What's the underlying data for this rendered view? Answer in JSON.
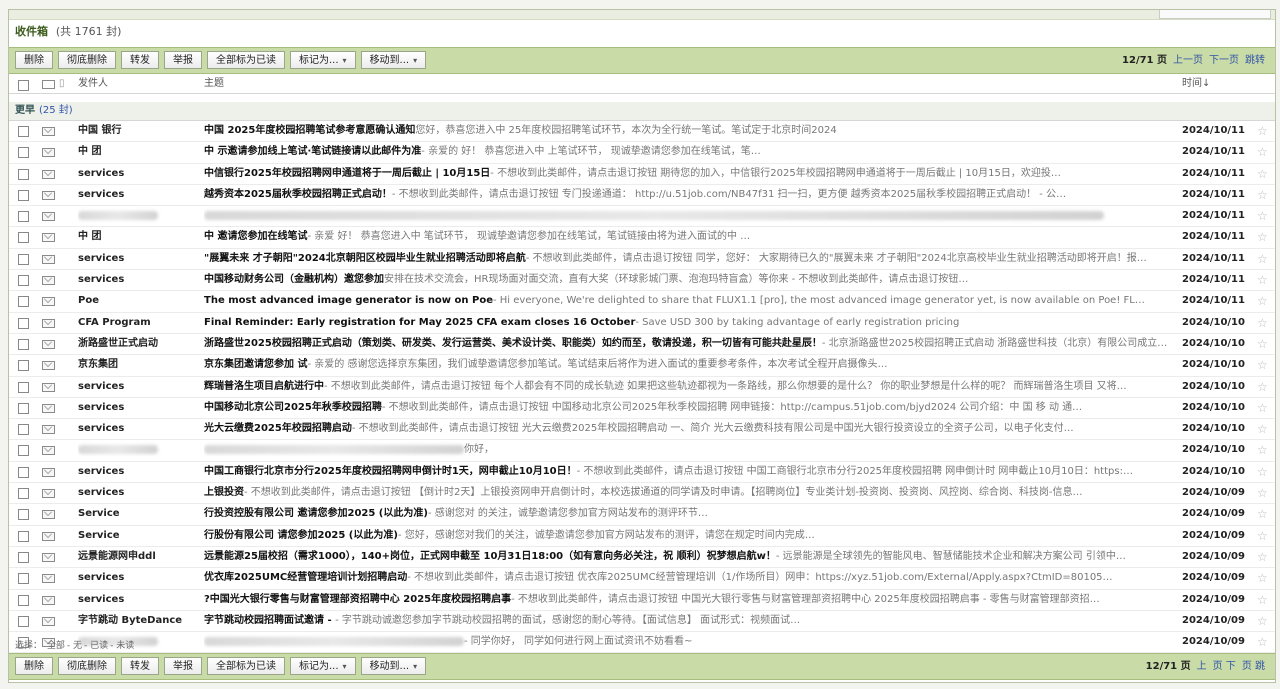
{
  "folder": {
    "title": "收件箱",
    "count": "(共 1761 封)"
  },
  "toolbar": {
    "buttons": [
      "删除",
      "彻底删除",
      "转发",
      "举报",
      "全部标为已读",
      "标记为...",
      "移动到..."
    ],
    "dropdown_caret": "▾",
    "page_top": "12/71 页",
    "prev": "上一页",
    "next": "下一页",
    "jump": "跳转",
    "page_bottom": "12/71 页",
    "bottom_up": "上",
    "bottom_down": "页 下",
    "bottom_jump": "页 跳"
  },
  "columns": {
    "sender": "发件人",
    "subject": "主题",
    "time": "时间↓"
  },
  "group": {
    "label": "更早",
    "count": "(25 封)"
  },
  "emails": [
    {
      "sender": "中国 银行",
      "subject": "中国 2025年度校园招聘笔试参考意愿确认通知",
      "preview": "您好，恭喜您进入中 25年度校园招聘笔试环节，本次为全行统一笔试。笔试定于北京时间2024",
      "date": "2024/10/11"
    },
    {
      "sender": "中  团",
      "subject": "中 示邀请参加线上笔试·笔试链接请以此邮件为准",
      "preview": "- 亲爱的 好！ 恭喜您进入中 上笔试环节， 现诚挚邀请您参加在线笔试，笔…",
      "date": "2024/10/11"
    },
    {
      "sender": "services",
      "subject": "中信银行2025年校园招聘网申通道将于一周后截止 | 10月15日",
      "preview": "- 不想收到此类邮件，请点击退订按钮 期待您的加入，中信银行2025年校园招聘网申通道将于一周后截止 | 10月15日，欢迎投…",
      "date": "2024/10/11"
    },
    {
      "sender": "services",
      "subject": "越秀资本2025届秋季校园招聘正式启动！",
      "preview": "- 不想收到此类邮件，请点击退订按钮 专门投递通道： http://u.51job.com/NB47f31 扫一扫，更方便 越秀资本2025届秋季校园招聘正式启动！ - 公…",
      "date": "2024/10/11"
    },
    {
      "sender": "",
      "subject": "",
      "preview": "",
      "date": "2024/10/11"
    },
    {
      "sender": "中  团",
      "subject": "中 邀请您参加在线笔试",
      "preview": "- 亲爱 好！ 恭喜您进入中 笔试环节， 现诚挚邀请您参加在线笔试，笔试链接由将为进入面试的中 …",
      "date": "2024/10/11"
    },
    {
      "sender": "services",
      "subject": "\"展翼未来 才子朝阳\"2024北京朝阳区校园毕业生就业招聘活动即将启航",
      "preview": "- 不想收到此类邮件，请点击退订按钮 同学，您好： 大家期待已久的\"展翼未来 才子朝阳\"2024北京高校毕业生就业招聘活动即将开启！报…",
      "date": "2024/10/11"
    },
    {
      "sender": "services",
      "subject": "中国移动财务公司（金融机构）邀您参加",
      "preview": "安排在技术交流会，HR现场面对面交流，直有大奖（环球影城门票、泡泡玛特盲盒）等你来 - 不想收到此类邮件，请点击退订按钮…",
      "date": "2024/10/11"
    },
    {
      "sender": "Poe",
      "subject": "The most advanced image generator is now on Poe",
      "preview": "- Hi everyone, We're delighted to share that FLUX1.1 [pro], the most advanced image generator yet, is now available on Poe! FL…",
      "date": "2024/10/11"
    },
    {
      "sender": "CFA Program",
      "subject": "Final Reminder: Early registration for May 2025 CFA exam closes 16 October",
      "preview": "- Save USD 300 by taking advantage of early registration pricing",
      "date": "2024/10/10"
    },
    {
      "sender": "浙路盛世正式启动",
      "subject": "浙路盛世2025校园招聘正式启动（策划类、研发类、发行运营类、美术设计类、职能类）如约而至，敬请投递，积一切皆有可能共赴星辰！",
      "preview": "- 北京浙路盛世2025校园招聘正式启动 浙路盛世科技（北京）有限公司成立…",
      "date": "2024/10/10"
    },
    {
      "sender": "京东集团",
      "subject": "京东集团邀请您参加 试",
      "preview": "- 亲爱的 感谢您选择京东集团，我们诚挚邀请您参加笔试。笔试结束后将作为进入面试的重要参考条件，本次考试全程开启摄像头…",
      "date": "2024/10/10"
    },
    {
      "sender": "services",
      "subject": "辉瑞普洛生项目启航进行中",
      "preview": "- 不想收到此类邮件，请点击退订按钮 每个人都会有不同的成长轨迹 如果把这些轨迹都视为一条路线，那么你想要的是什么？ 你的职业梦想是什么样的呢？ 而辉瑞普洛生项目 又将…",
      "date": "2024/10/10"
    },
    {
      "sender": "services",
      "subject": "中国移动北京公司2025年秋季校园招聘",
      "preview": "- 不想收到此类邮件，请点击退订按钮 中国移动北京公司2025年秋季校园招聘 网申链接：http://campus.51job.com/bjyd2024 公司介绍：中 国 移 动 通…",
      "date": "2024/10/10"
    },
    {
      "sender": "services",
      "subject": "光大云缴费2025年校园招聘启动",
      "preview": "- 不想收到此类邮件，请点击退订按钮 光大云缴费2025年校园招聘启动 一、简介 光大云缴费科技有限公司是中国光大银行投资设立的全资子公司，以电子化支付…",
      "date": "2024/10/10"
    },
    {
      "sender": "",
      "subject": "",
      "preview": "你好，",
      "date": "2024/10/10"
    },
    {
      "sender": "services",
      "subject": "中国工商银行北京市分行2025年度校园招聘网申倒计时1天，网申截止10月10日！",
      "preview": "- 不想收到此类邮件，请点击退订按钮 中国工商银行北京市分行2025年度校园招聘 网申倒计时 网申截止10月10日：https:…",
      "date": "2024/10/10"
    },
    {
      "sender": "services",
      "subject": "上银投资",
      "preview": "- 不想收到此类邮件，请点击退订按钮 【倒计时2天】上银投资网申开启倒计时，本校选拔通道的同学请及时申请。【招聘岗位】专业类计划-投资岗、投资岗、风控岗、综合岗、科技岗-信息…",
      "date": "2024/10/09"
    },
    {
      "sender": "Service",
      "subject": "行投资控股有限公司 邀请您参加2025 (以此为准)",
      "preview": "- 感谢您对 的关注，诚挚邀请您参加官方网站发布的测评环节…",
      "date": "2024/10/09"
    },
    {
      "sender": "Service",
      "subject": "行股份有限公司 请您参加2025 (以此为准)",
      "preview": "- 您好，感谢您对我们的关注，诚挚邀请您参加官方网站发布的测评，请您在规定时间内完成…",
      "date": "2024/10/09"
    },
    {
      "sender": "远景能源网申ddl",
      "subject": "远景能源25届校招（需求1000），140+岗位，正式网申截至 10月31日18:00（如有意向务必关注，祝 顺利）祝梦想启航w！",
      "preview": "- 远景能源是全球领先的智能风电、智慧储能技术企业和解决方案公司 引领中…",
      "date": "2024/10/09"
    },
    {
      "sender": "services",
      "subject": "优衣库2025UMC经营管理培训计划招聘启动",
      "preview": "- 不想收到此类邮件，请点击退订按钮 优衣库2025UMC经营管理培训（1/作场所目）网申：https://xyz.51job.com/External/Apply.aspx?CtmID=80105…",
      "date": "2024/10/09"
    },
    {
      "sender": "services",
      "subject": "?中国光大银行零售与财富管理部资招聘中心 2025年度校园招聘启事",
      "preview": "- 不想收到此类邮件，请点击退订按钮 中国光大银行零售与财富管理部资招聘中心 2025年度校园招聘启事 - 零售与财富管理部资招…",
      "date": "2024/10/09"
    },
    {
      "sender": "字节跳动 ByteDance",
      "subject": "字节跳动校园招聘面试邀请 - ",
      "preview": "- 字节跳动诚邀您参加字节跳动校园招聘的面试，感谢您的耐心等待。【面试信息】 面试形式：视频面试…",
      "date": "2024/10/09"
    },
    {
      "sender": "",
      "subject": "",
      "preview": "- 同学你好， 同学如何进行网上面试资讯不妨看看~",
      "date": "2024/10/09"
    }
  ],
  "selection": {
    "label": "选择：",
    "all": "全部",
    "none": "无",
    "read": "已读",
    "unread": "未读"
  }
}
